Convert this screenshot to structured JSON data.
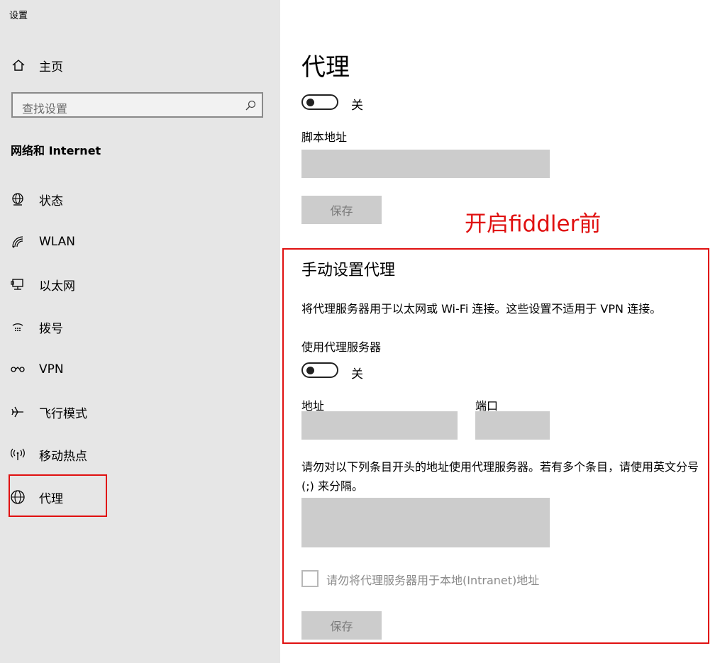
{
  "window": {
    "title": "设置"
  },
  "sidebar": {
    "home_label": "主页",
    "search_placeholder": "查找设置",
    "section_title": "网络和 Internet",
    "items": [
      {
        "label": "状态",
        "icon": "globe-status-icon"
      },
      {
        "label": "WLAN",
        "icon": "wifi-icon"
      },
      {
        "label": "以太网",
        "icon": "ethernet-icon"
      },
      {
        "label": "拨号",
        "icon": "dialup-icon"
      },
      {
        "label": "VPN",
        "icon": "vpn-icon"
      },
      {
        "label": "飞行模式",
        "icon": "airplane-icon"
      },
      {
        "label": "移动热点",
        "icon": "hotspot-icon"
      },
      {
        "label": "代理",
        "icon": "globe-icon"
      }
    ]
  },
  "main": {
    "title": "代理",
    "auto": {
      "toggle_state": "关",
      "script_label": "脚本地址",
      "script_value": "",
      "save_label": "保存"
    },
    "annotation": "开启fiddler前",
    "manual": {
      "title": "手动设置代理",
      "description": "将代理服务器用于以太网或 Wi-Fi 连接。这些设置不适用于 VPN 连接。",
      "use_proxy_label": "使用代理服务器",
      "toggle_state": "关",
      "address_label": "地址",
      "address_value": "",
      "port_label": "端口",
      "port_value": "",
      "exclude_text": "请勿对以下列条目开头的地址使用代理服务器。若有多个条目，请使用英文分号 (;) 来分隔。",
      "exclude_value": "",
      "local_checkbox_label": "请勿将代理服务器用于本地(Intranet)地址",
      "local_checked": false,
      "save_label": "保存"
    }
  },
  "colors": {
    "annotation": "#e01010",
    "field": "#cccccc",
    "sidebar_bg": "#e6e6e6"
  }
}
